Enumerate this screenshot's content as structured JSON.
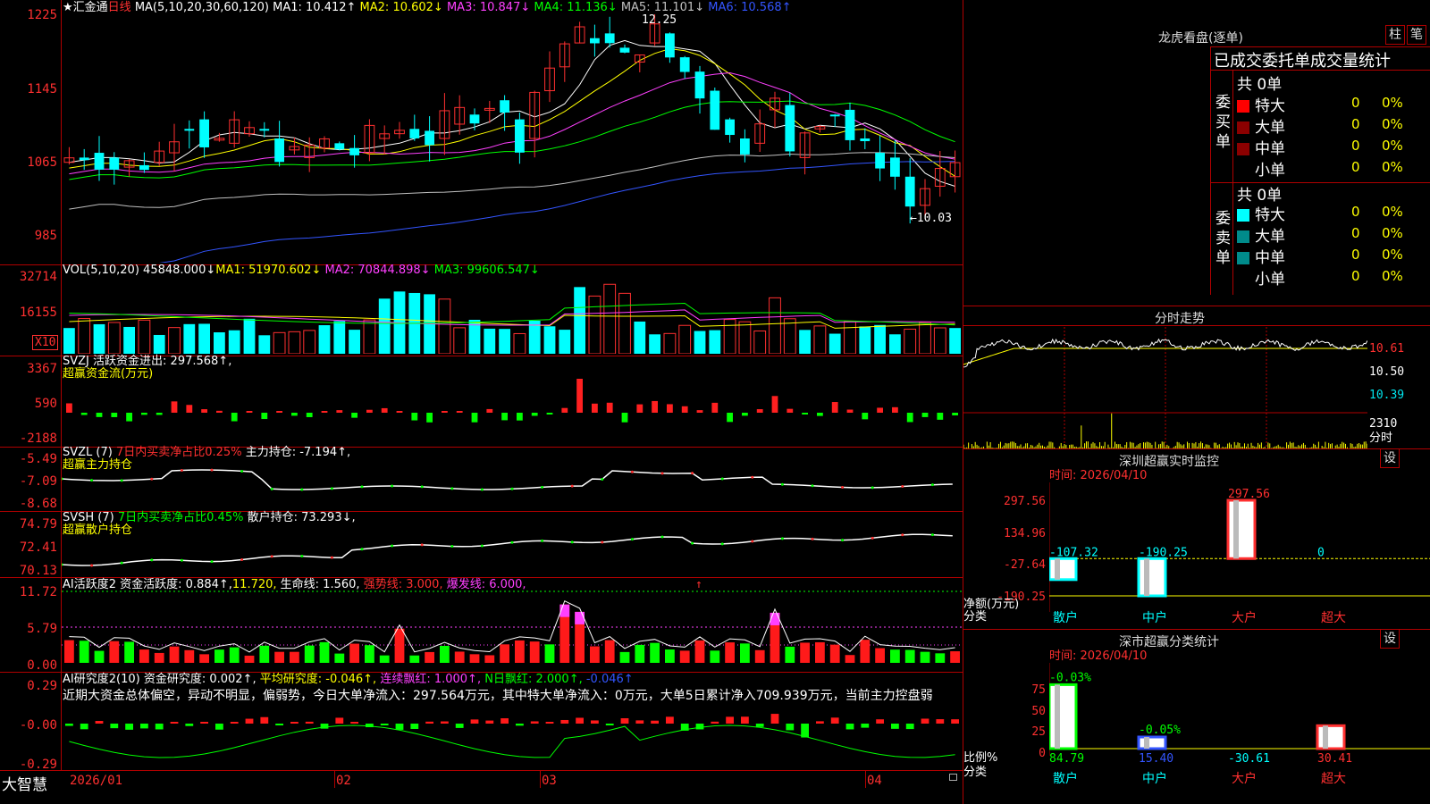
{
  "main": {
    "stock_name": "★汇金通",
    "period": "日线",
    "ma_header": "MA(5,10,20,30,60,120)",
    "ma1": "MA1: 10.412↑",
    "ma2": "MA2: 10.602↓",
    "ma3": "MA3: 10.847↓",
    "ma4": "MA4: 11.136↓",
    "ma5": "MA5: 11.101↓",
    "ma6": "MA6: 10.568↑",
    "y_ticks": [
      "1225",
      "1145",
      "1065",
      "985"
    ],
    "high_label": "12.25",
    "low_label": "←10.03"
  },
  "vol": {
    "header": "VOL(5,10,20)",
    "value": "45848.000↓",
    "ma1": "MA1: 51970.602↓",
    "ma2": "MA2: 70844.898↓",
    "ma3": "MA3: 99606.547↓",
    "y_ticks": [
      "32714",
      "16155"
    ],
    "unit": "X10"
  },
  "svzj": {
    "header": "SVZJ",
    "label": "活跃资金进出: 297.568↑,",
    "sub": "超赢资金流(万元)",
    "y_ticks": [
      "3367",
      "590",
      "-2188"
    ]
  },
  "svzl": {
    "header": "SVZL (7)",
    "label1": "7日内买卖净占比0.25%",
    "label2": "主力持仓: -7.194↑,",
    "sub": "超赢主力持仓",
    "y_ticks": [
      "-5.49",
      "-7.09",
      "-8.68"
    ]
  },
  "svsh": {
    "header": "SVSH (7)",
    "label1": "7日内买卖净占比0.45%",
    "label2": "散户持仓: 73.293↓,",
    "sub": "超赢散户持仓",
    "y_ticks": [
      "74.79",
      "72.41",
      "70.13"
    ]
  },
  "ai1": {
    "header": "AI活跃度2",
    "label1": "资金活跃度: 0.884↑,",
    "label2": "11.720,",
    "label3": "生命线: 1.560,",
    "label4": "强势线: 3.000,",
    "label5": "爆发线: 6.000,",
    "arrow": "↑",
    "y_ticks": [
      "11.72",
      "5.79",
      "0.00"
    ]
  },
  "ai2": {
    "header": "AI研究度2(10)",
    "label1": "资金研究度: 0.002↑,",
    "label2": "平均研究度: -0.046↑,",
    "label3": "连续飘红: 1.000↑,",
    "label4": "N日飘红: 2.000↑,",
    "label5": "-0.046↑",
    "comment": "近期大资金总体偏空，异动不明显，偏弱势，今日大单净流入：297.564万元，其中特大单净流入：0万元，大单5日累计净入709.939万元，当前主力控盘弱",
    "y_ticks": [
      "0.29",
      "-0.00",
      "-0.29"
    ]
  },
  "bottom": {
    "brand": "大智慧",
    "dates": [
      "2026/01",
      "02",
      "03",
      "04"
    ]
  },
  "right": {
    "lhb_title": "龙虎看盘(逐单)",
    "btn_col": "柱",
    "btn_pen": "笔",
    "order_title": "已成交委托单成交量统计",
    "buy_side": "委买单",
    "sell_side": "委卖单",
    "buy_total": "共 0单",
    "sell_total": "共 0单",
    "rows": [
      "特大",
      "大单",
      "中单",
      "小单"
    ],
    "zero": "0",
    "pct": "0%",
    "fs_title": "分时走势",
    "fs_prices": [
      "10.61",
      "10.50",
      "10.39"
    ],
    "fs_vol": "2310",
    "fs_vol_label": "分时",
    "sz_title": "深圳超赢实时监控",
    "sz_btn": "设",
    "sz_time": "时间: 2026/04/10",
    "sz_y_ticks": [
      "297.56",
      "134.96",
      "-27.64",
      "-190.25"
    ],
    "sz_ylabel": "净额(万元)",
    "sz_xlabel": "分类",
    "ss_title": "深市超赢分类统计",
    "ss_btn": "设",
    "ss_time": "时间: 2026/04/10",
    "ss_y_ticks": [
      "75",
      "50",
      "25",
      "0"
    ],
    "ss_ylabel": "比例%",
    "ss_xlabel": "分类",
    "colors": {
      "red": "#ff0000",
      "dark_red": "#8b0000",
      "cyan": "#00ffff",
      "teal": "#008b8b"
    }
  },
  "chart_data": [
    {
      "type": "bar",
      "title": "深圳超赢实时监控",
      "categories": [
        "散户",
        "中户",
        "大户",
        "超大"
      ],
      "values": [
        -107.32,
        -190.25,
        297.56,
        0
      ],
      "value_labels": [
        "-107.32",
        "-190.25",
        "297.56",
        "0"
      ],
      "ylabel": "净额(万元)",
      "xlabel": "分类",
      "ylim": [
        -190.25,
        297.56
      ]
    },
    {
      "type": "bar",
      "title": "深市超赢分类统计",
      "categories": [
        "散户",
        "中户",
        "大户",
        "超大"
      ],
      "series": [
        {
          "values": [
            84.79,
            15.4,
            -30.61,
            30.41
          ]
        },
        {
          "values": [
            -0.03,
            -0.05,
            null,
            null
          ]
        }
      ],
      "bottom_labels": [
        "84.79",
        "15.40",
        "-30.61",
        "30.41"
      ],
      "top_labels": [
        "-0.03%",
        "-0.05%",
        "",
        ""
      ],
      "ylabel": "比例%",
      "xlabel": "分类",
      "ylim": [
        0,
        90
      ]
    }
  ]
}
